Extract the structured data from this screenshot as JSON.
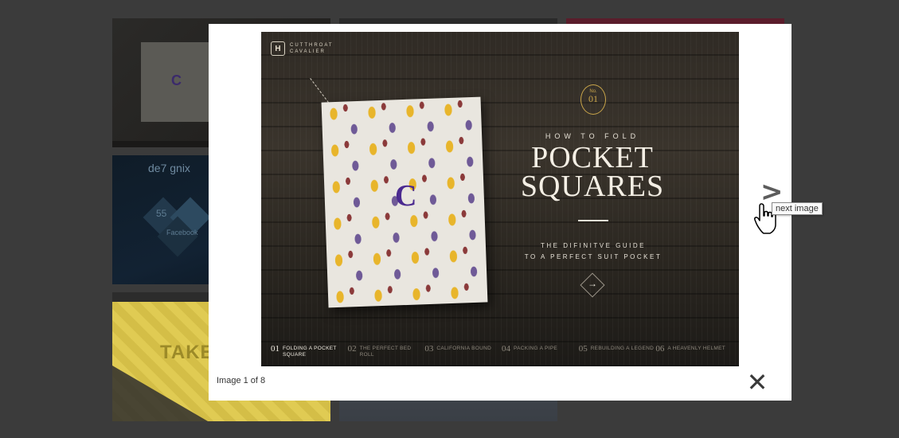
{
  "background_gallery": {
    "thumb_1": {
      "text": "C"
    },
    "thumb_4": {
      "title": "de7 gnix",
      "number": "55",
      "label": "Facebook"
    },
    "thumb_5": {
      "text": "TAKE"
    }
  },
  "lightbox": {
    "image": {
      "brand": {
        "logo": "H",
        "name": "CUTTHROAT CAVALIER"
      },
      "monogram": "C",
      "badge": {
        "no": "No.",
        "number": "01"
      },
      "kicker": "HOW TO FOLD",
      "headline_line1": "POCKET",
      "headline_line2": "SQUARES",
      "guide_line1": "THE DIFINITVE GUIDE",
      "guide_line2": "TO A PERFECT SUIT POCKET",
      "go_arrow": "→",
      "chapters": [
        {
          "num": "01",
          "name": "FOLDING A POCKET SQUARE"
        },
        {
          "num": "02",
          "name": "THE PERFECT BED ROLL"
        },
        {
          "num": "03",
          "name": "CALIFORNIA BOUND"
        },
        {
          "num": "04",
          "name": "PACKING A PIPE"
        },
        {
          "num": "05",
          "name": "REBUILDING A LEGEND"
        },
        {
          "num": "06",
          "name": "A HEAVENLY HELMET"
        }
      ]
    },
    "caption": "Image 1 of 8",
    "close_symbol": "✕"
  },
  "next_control": {
    "symbol": ">",
    "tooltip": "next image"
  }
}
